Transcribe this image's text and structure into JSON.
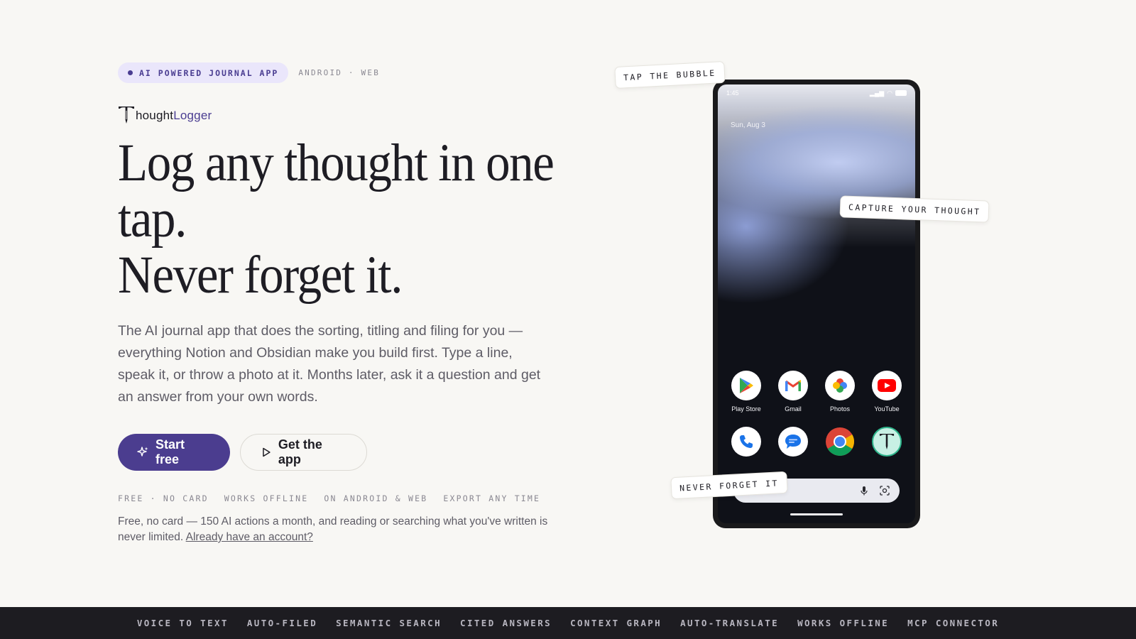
{
  "hero": {
    "pill": "AI POWERED JOURNAL APP",
    "platforms": "ANDROID · WEB",
    "logo": {
      "part1": "hought",
      "part2": "Logger"
    },
    "headline_line1": "Log any thought in one",
    "headline_line2": "tap.",
    "headline_line3": "Never forget it.",
    "lede": "The AI journal app that does the sorting, titling and filing for you — everything Notion and Obsidian make you build first. Type a line, speak it, or throw a photo at it. Months later, ask it a question and get an answer from your own words.",
    "cta_primary": "Start free",
    "cta_secondary": "Get the app",
    "features": [
      "FREE · NO CARD",
      "WORKS OFFLINE",
      "ON ANDROID & WEB",
      "EXPORT ANY TIME"
    ],
    "fine_print": "Free, no card — 150 AI actions a month, and reading or searching what you've written is never limited. ",
    "signin_link": "Already have an account?"
  },
  "phone": {
    "time": "1:45",
    "date": "Sun, Aug 3",
    "apps": [
      {
        "label": "Play Store",
        "icon": "play-store-icon"
      },
      {
        "label": "Gmail",
        "icon": "gmail-icon"
      },
      {
        "label": "Photos",
        "icon": "photos-icon"
      },
      {
        "label": "YouTube",
        "icon": "youtube-icon"
      },
      {
        "label": "",
        "icon": "phone-icon"
      },
      {
        "label": "",
        "icon": "messages-icon"
      },
      {
        "label": "",
        "icon": "chrome-icon"
      },
      {
        "label": "",
        "icon": "thoughtlogger-icon"
      }
    ]
  },
  "callouts": {
    "tap": "TAP THE BUBBLE",
    "capture": "CAPTURE YOUR THOUGHT",
    "never": "NEVER FORGET IT"
  },
  "band": [
    "VOICE TO TEXT",
    "AUTO-FILED",
    "SEMANTIC SEARCH",
    "CITED ANSWERS",
    "CONTEXT GRAPH",
    "AUTO-TRANSLATE",
    "WORKS OFFLINE",
    "MCP CONNECTOR"
  ],
  "colors": {
    "accent": "#4b3d8f",
    "pill_bg": "#eae6fb",
    "page_bg": "#f8f7f4",
    "band_bg": "#1d1c21"
  }
}
